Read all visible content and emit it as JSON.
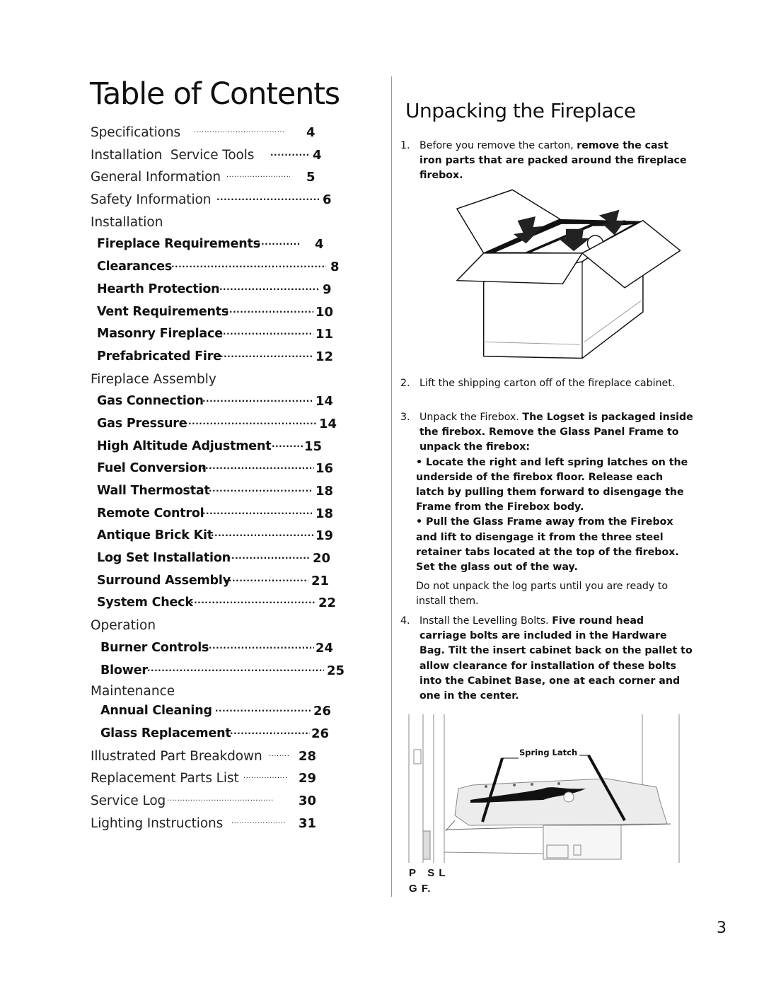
{
  "toc": {
    "title": "Table of Contents",
    "entries": [
      {
        "label": "Specifications",
        "page": "4"
      },
      {
        "label": "Installation  Service Tools",
        "page": "4"
      },
      {
        "label": "General Information",
        "page": "5"
      },
      {
        "label": "Safety Information",
        "page": "6"
      },
      {
        "label": "Installation",
        "page": ""
      },
      {
        "label": "Fireplace Requirements",
        "page": "4"
      },
      {
        "label": "Clearances",
        "page": "8"
      },
      {
        "label": "Hearth Protection",
        "page": "9"
      },
      {
        "label": "Vent Requirements",
        "page": "10"
      },
      {
        "label": "Masonry Fireplace",
        "page": "11"
      },
      {
        "label": "Prefabricated Fire",
        "page": "12"
      },
      {
        "label": "Fireplace Assembly",
        "page": ""
      },
      {
        "label": "Gas Connection",
        "page": "14"
      },
      {
        "label": "Gas Pressure",
        "page": "14"
      },
      {
        "label": "High Altitude Adjustment",
        "page": "15"
      },
      {
        "label": "Fuel Conversion",
        "page": "16"
      },
      {
        "label": "Wall Thermostat",
        "page": "18"
      },
      {
        "label": "Remote Control",
        "page": "18"
      },
      {
        "label": "Antique Brick Kit",
        "page": "19"
      },
      {
        "label": "Log Set Installation",
        "page": "20"
      },
      {
        "label": "Surround Assembly",
        "page": "21"
      },
      {
        "label": "System Check",
        "page": "22"
      },
      {
        "label": "Operation",
        "page": ""
      },
      {
        "label": "Burner Controls",
        "page": "24"
      },
      {
        "label": "Blower",
        "page": "25"
      },
      {
        "label": "Maintenance",
        "page": ""
      },
      {
        "label": "Annual Cleaning",
        "page": "26"
      },
      {
        "label": "Glass Replacement",
        "page": "26"
      },
      {
        "label": "Illustrated Part Breakdown",
        "page": "28"
      },
      {
        "label": "Replacement Parts List",
        "page": "29"
      },
      {
        "label": "Service Log",
        "page": "30"
      },
      {
        "label": "Lighting Instructions",
        "page": "31"
      }
    ]
  },
  "unpacking": {
    "title": "Unpacking the Fireplace",
    "steps": [
      {
        "num": "1.",
        "plain": "Before you remove the carton, ",
        "bold": "remove the cast iron parts that are packed around the fireplace firebox."
      },
      {
        "num": "2.",
        "plain": "Lift the shipping carton off of the fireplace cabinet.",
        "bold": ""
      },
      {
        "num": "3.",
        "plain": "Unpack the Firebox. ",
        "bold": "The Logset is packaged inside the firebox. Remove the Glass Panel Frame to unpack the firebox:",
        "bullets": [
          "•  Locate the right and left spring latches on the underside of the firebox floor. Release each latch by pulling them forward to disengage the Frame from the Firebox body.",
          "•  Pull the Glass Frame away from the Firebox and lift to disengage it from the three steel retainer tabs located at the top of the firebox. Set the glass out of the way."
        ],
        "note": "Do not unpack the log parts until you are ready to install them."
      },
      {
        "num": "4.",
        "plain": "Install the Levelling Bolts.  ",
        "bold": "Five round head carriage bolts are included in the Hardware Bag. Tilt the insert cabinet back on the pallet to allow clearance for installation of these bolts into the Cabinet Base, one at each corner and one in the center."
      }
    ],
    "figure_label": "Spring Latch",
    "figure_code_line1": "P   S L",
    "figure_code_line2": "G F."
  },
  "page_number": "3"
}
